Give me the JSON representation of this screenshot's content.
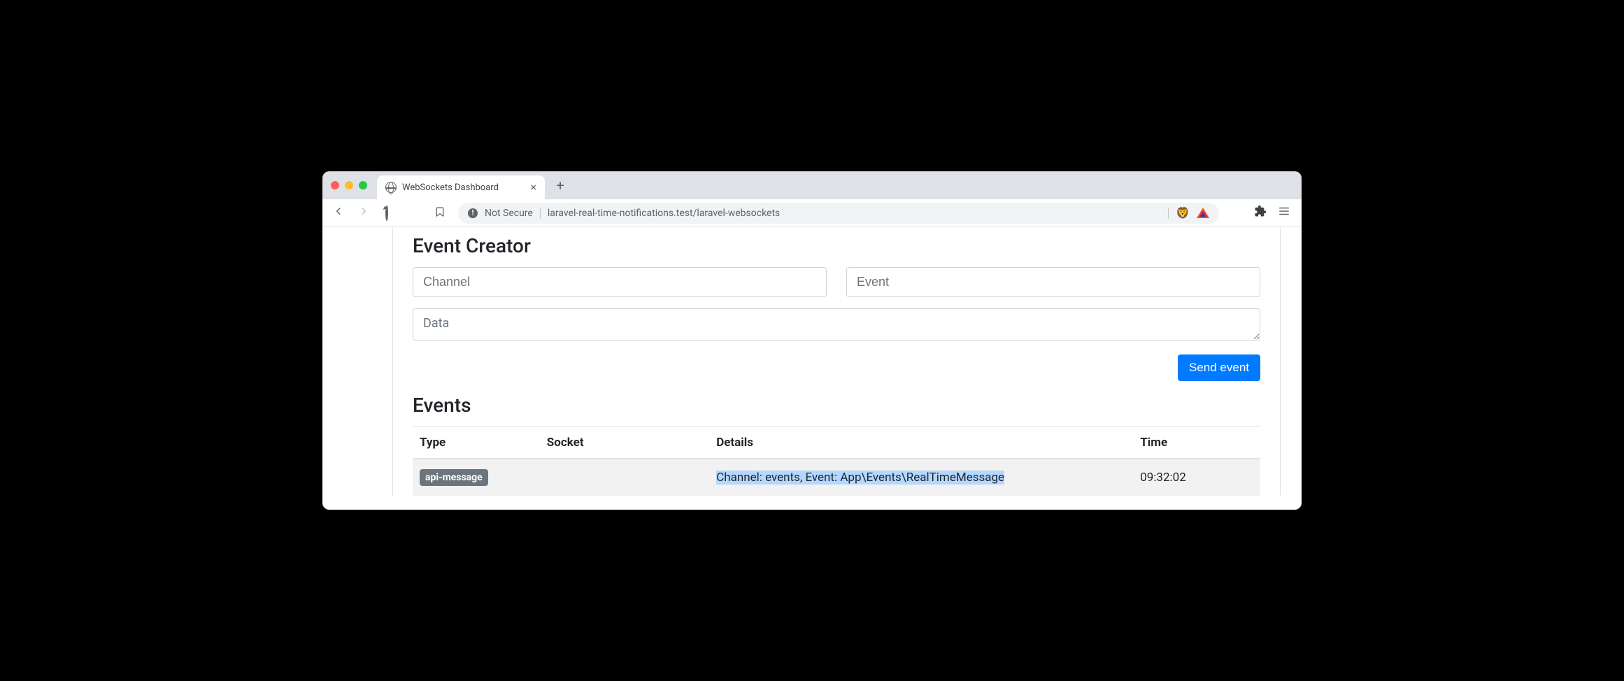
{
  "browser": {
    "tab_title": "WebSockets Dashboard",
    "not_secure_label": "Not Secure",
    "url": "laravel-real-time-notifications.test/laravel-websockets"
  },
  "event_creator": {
    "title": "Event Creator",
    "channel_placeholder": "Channel",
    "event_placeholder": "Event",
    "data_placeholder": "Data",
    "send_button": "Send event"
  },
  "events": {
    "title": "Events",
    "columns": {
      "type": "Type",
      "socket": "Socket",
      "details": "Details",
      "time": "Time"
    },
    "rows": [
      {
        "type_badge": "api-message",
        "socket": "",
        "details": "Channel: events, Event: App\\Events\\RealTimeMessage",
        "time": "09:32:02"
      }
    ]
  }
}
